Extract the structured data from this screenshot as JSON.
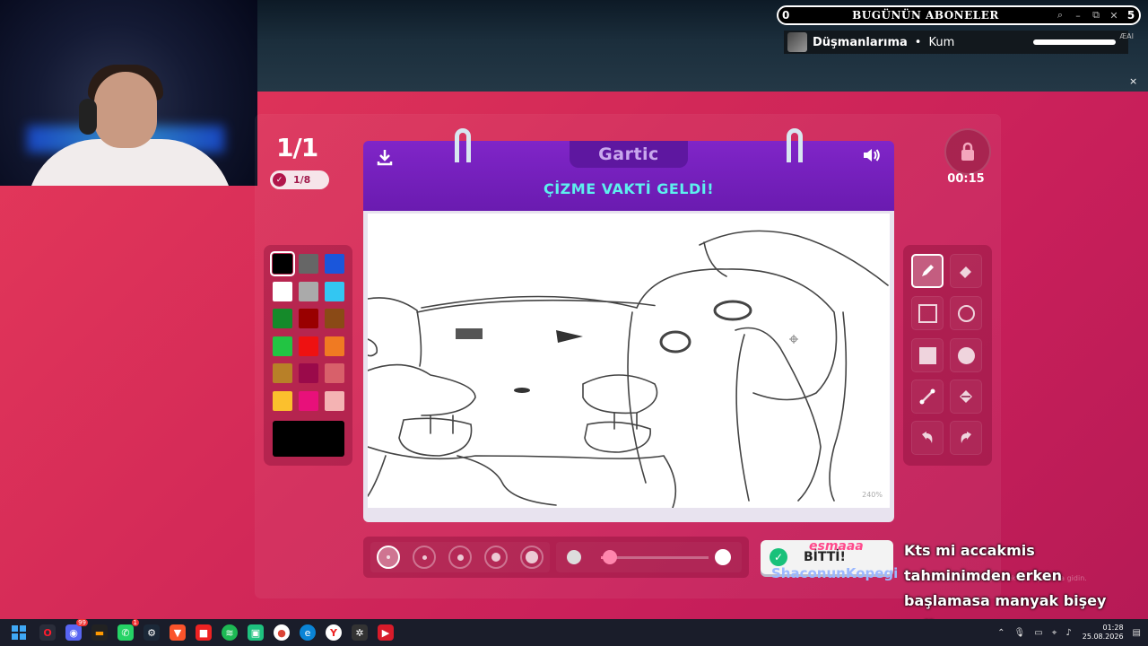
{
  "stream": {
    "subs_count": "0",
    "subs_title": "BUGÜNÜN ABONELER",
    "subs_controls": {
      "minimize": "–",
      "maximize": "⧉",
      "close": "✕",
      "number": "5"
    },
    "sub_entry": {
      "name": "Düşmanlarıma",
      "dot": "•",
      "value": "Kum",
      "ai": "ÆAI"
    },
    "close_label": "×"
  },
  "game": {
    "round": "1/1",
    "progress": "1/8",
    "brand": "Gartic",
    "prompt": "ÇİZME VAKTİ GELDİ!",
    "timer": "00:15",
    "zoom": "240%",
    "done_label": "BİTTİ!",
    "palette": [
      "#000000",
      "#666666",
      "#1a56db",
      "#ffffff",
      "#aaaaaa",
      "#33c6f2",
      "#158a2a",
      "#990000",
      "#8a4a16",
      "#22c443",
      "#ee1111",
      "#f07a22",
      "#b88028",
      "#9a0a4a",
      "#d8606a",
      "#fbc02d",
      "#e8107a",
      "#f4b3b3"
    ],
    "selected_color": "#000000",
    "brush_sizes": [
      1,
      2,
      3,
      4,
      5
    ],
    "selected_size": 1,
    "opacity": 0.32
  },
  "chat": {
    "user1": "esmaaa",
    "user2": "ShaconunKopegi",
    "message": "Kts mi accakmis tahminimden erken başlamasa manyak bişey geliyor",
    "win_note": "Windows'u etkinleştirmek için Ayarlar'a gidin."
  },
  "taskbar": {
    "badge_discord": "99",
    "badge_whatsapp": "1",
    "time": "01:28",
    "date": "25.08.2026"
  }
}
